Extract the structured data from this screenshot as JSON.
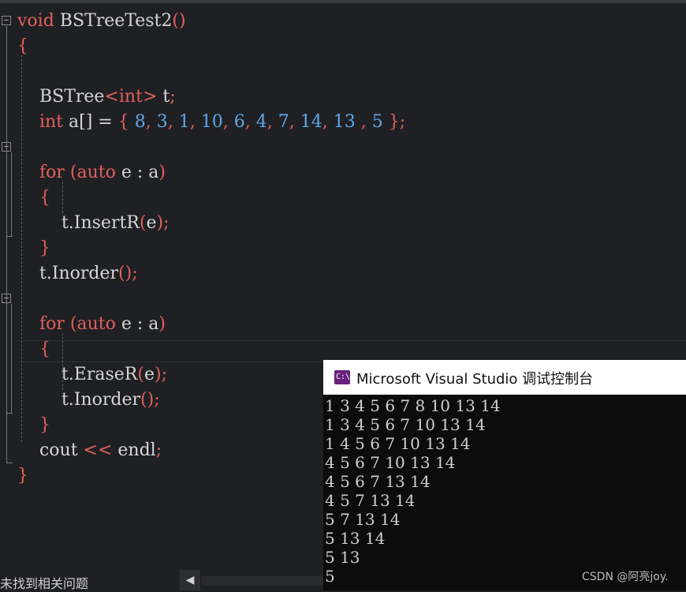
{
  "editor": {
    "lines": [
      {
        "tokens": [
          {
            "t": "void",
            "c": "kw"
          },
          {
            "t": " BSTreeTest2",
            "c": "tp"
          },
          {
            "t": "()",
            "c": "br"
          }
        ]
      },
      {
        "tokens": [
          {
            "t": "{",
            "c": "br"
          }
        ]
      },
      {
        "tokens": []
      },
      {
        "tokens": [
          {
            "t": "    BSTree",
            "c": "tp"
          },
          {
            "t": "<",
            "c": "br"
          },
          {
            "t": "int",
            "c": "kw"
          },
          {
            "t": ">",
            "c": "br"
          },
          {
            "t": " t",
            "c": "tp"
          },
          {
            "t": ";",
            "c": "br"
          }
        ]
      },
      {
        "tokens": [
          {
            "t": "    int",
            "c": "kw"
          },
          {
            "t": " a[] = ",
            "c": "tp"
          },
          {
            "t": "{",
            "c": "br"
          },
          {
            "t": " 8",
            "c": "num"
          },
          {
            "t": ",",
            "c": "br"
          },
          {
            "t": " 3",
            "c": "num"
          },
          {
            "t": ",",
            "c": "br"
          },
          {
            "t": " 1",
            "c": "num"
          },
          {
            "t": ",",
            "c": "br"
          },
          {
            "t": " 10",
            "c": "num"
          },
          {
            "t": ",",
            "c": "br"
          },
          {
            "t": " 6",
            "c": "num"
          },
          {
            "t": ",",
            "c": "br"
          },
          {
            "t": " 4",
            "c": "num"
          },
          {
            "t": ",",
            "c": "br"
          },
          {
            "t": " 7",
            "c": "num"
          },
          {
            "t": ",",
            "c": "br"
          },
          {
            "t": " 14",
            "c": "num"
          },
          {
            "t": ",",
            "c": "br"
          },
          {
            "t": " 13",
            "c": "num"
          },
          {
            "t": " ,",
            "c": "br"
          },
          {
            "t": " 5",
            "c": "num"
          },
          {
            "t": " };",
            "c": "br"
          }
        ]
      },
      {
        "tokens": []
      },
      {
        "tokens": [
          {
            "t": "    for",
            "c": "kw"
          },
          {
            "t": " (",
            "c": "br"
          },
          {
            "t": "auto",
            "c": "kw"
          },
          {
            "t": " e : a",
            "c": "tp"
          },
          {
            "t": ")",
            "c": "br"
          }
        ]
      },
      {
        "tokens": [
          {
            "t": "    {",
            "c": "br"
          }
        ]
      },
      {
        "tokens": [
          {
            "t": "        t.InsertR",
            "c": "fn"
          },
          {
            "t": "(",
            "c": "br"
          },
          {
            "t": "e",
            "c": "tp"
          },
          {
            "t": ");",
            "c": "br"
          }
        ]
      },
      {
        "tokens": [
          {
            "t": "    }",
            "c": "br"
          }
        ]
      },
      {
        "tokens": [
          {
            "t": "    t.Inorder",
            "c": "fn"
          },
          {
            "t": "();",
            "c": "br"
          }
        ]
      },
      {
        "tokens": []
      },
      {
        "tokens": [
          {
            "t": "    for",
            "c": "kw"
          },
          {
            "t": " (",
            "c": "br"
          },
          {
            "t": "auto",
            "c": "kw"
          },
          {
            "t": " e : a",
            "c": "tp"
          },
          {
            "t": ")",
            "c": "br"
          }
        ]
      },
      {
        "tokens": [
          {
            "t": "    {",
            "c": "br"
          }
        ]
      },
      {
        "tokens": [
          {
            "t": "        t.EraseR",
            "c": "fn"
          },
          {
            "t": "(",
            "c": "br"
          },
          {
            "t": "e",
            "c": "tp"
          },
          {
            "t": ");",
            "c": "br"
          }
        ]
      },
      {
        "tokens": [
          {
            "t": "        t.Inorder",
            "c": "fn"
          },
          {
            "t": "();",
            "c": "br"
          }
        ]
      },
      {
        "tokens": [
          {
            "t": "    }",
            "c": "br"
          }
        ]
      },
      {
        "tokens": [
          {
            "t": "    cout ",
            "c": "tp"
          },
          {
            "t": "<<",
            "c": "br"
          },
          {
            "t": " endl",
            "c": "tp"
          },
          {
            "t": ";",
            "c": "br"
          }
        ]
      },
      {
        "tokens": [
          {
            "t": "}",
            "c": "br"
          }
        ]
      }
    ],
    "collapse_icon": "minus-box-icon",
    "collapse_glyph": "−"
  },
  "status_bar": {
    "message": "未找到相关问题",
    "scroll_left_glyph": "◀"
  },
  "console": {
    "title": "Microsoft Visual Studio 调试控制台",
    "icon": "vs-console-icon",
    "icon_text": "C:\\",
    "output": [
      "1 3 4 5 6 7 8 10 13 14",
      "1 3 4 5 6 7 10 13 14",
      "1 4 5 6 7 10 13 14",
      "4 5 6 7 10 13 14",
      "4 5 6 7 13 14",
      "4 5 7 13 14",
      "5 7 13 14",
      "5 13 14",
      "5 13",
      "5"
    ],
    "watermark": "CSDN @阿亮joy."
  },
  "colors": {
    "keyword": "#e0605c",
    "number": "#5fa8e8",
    "text": "#d6d6d6",
    "editor_bg": "#1f2023",
    "console_bg": "#0c0c0c"
  }
}
